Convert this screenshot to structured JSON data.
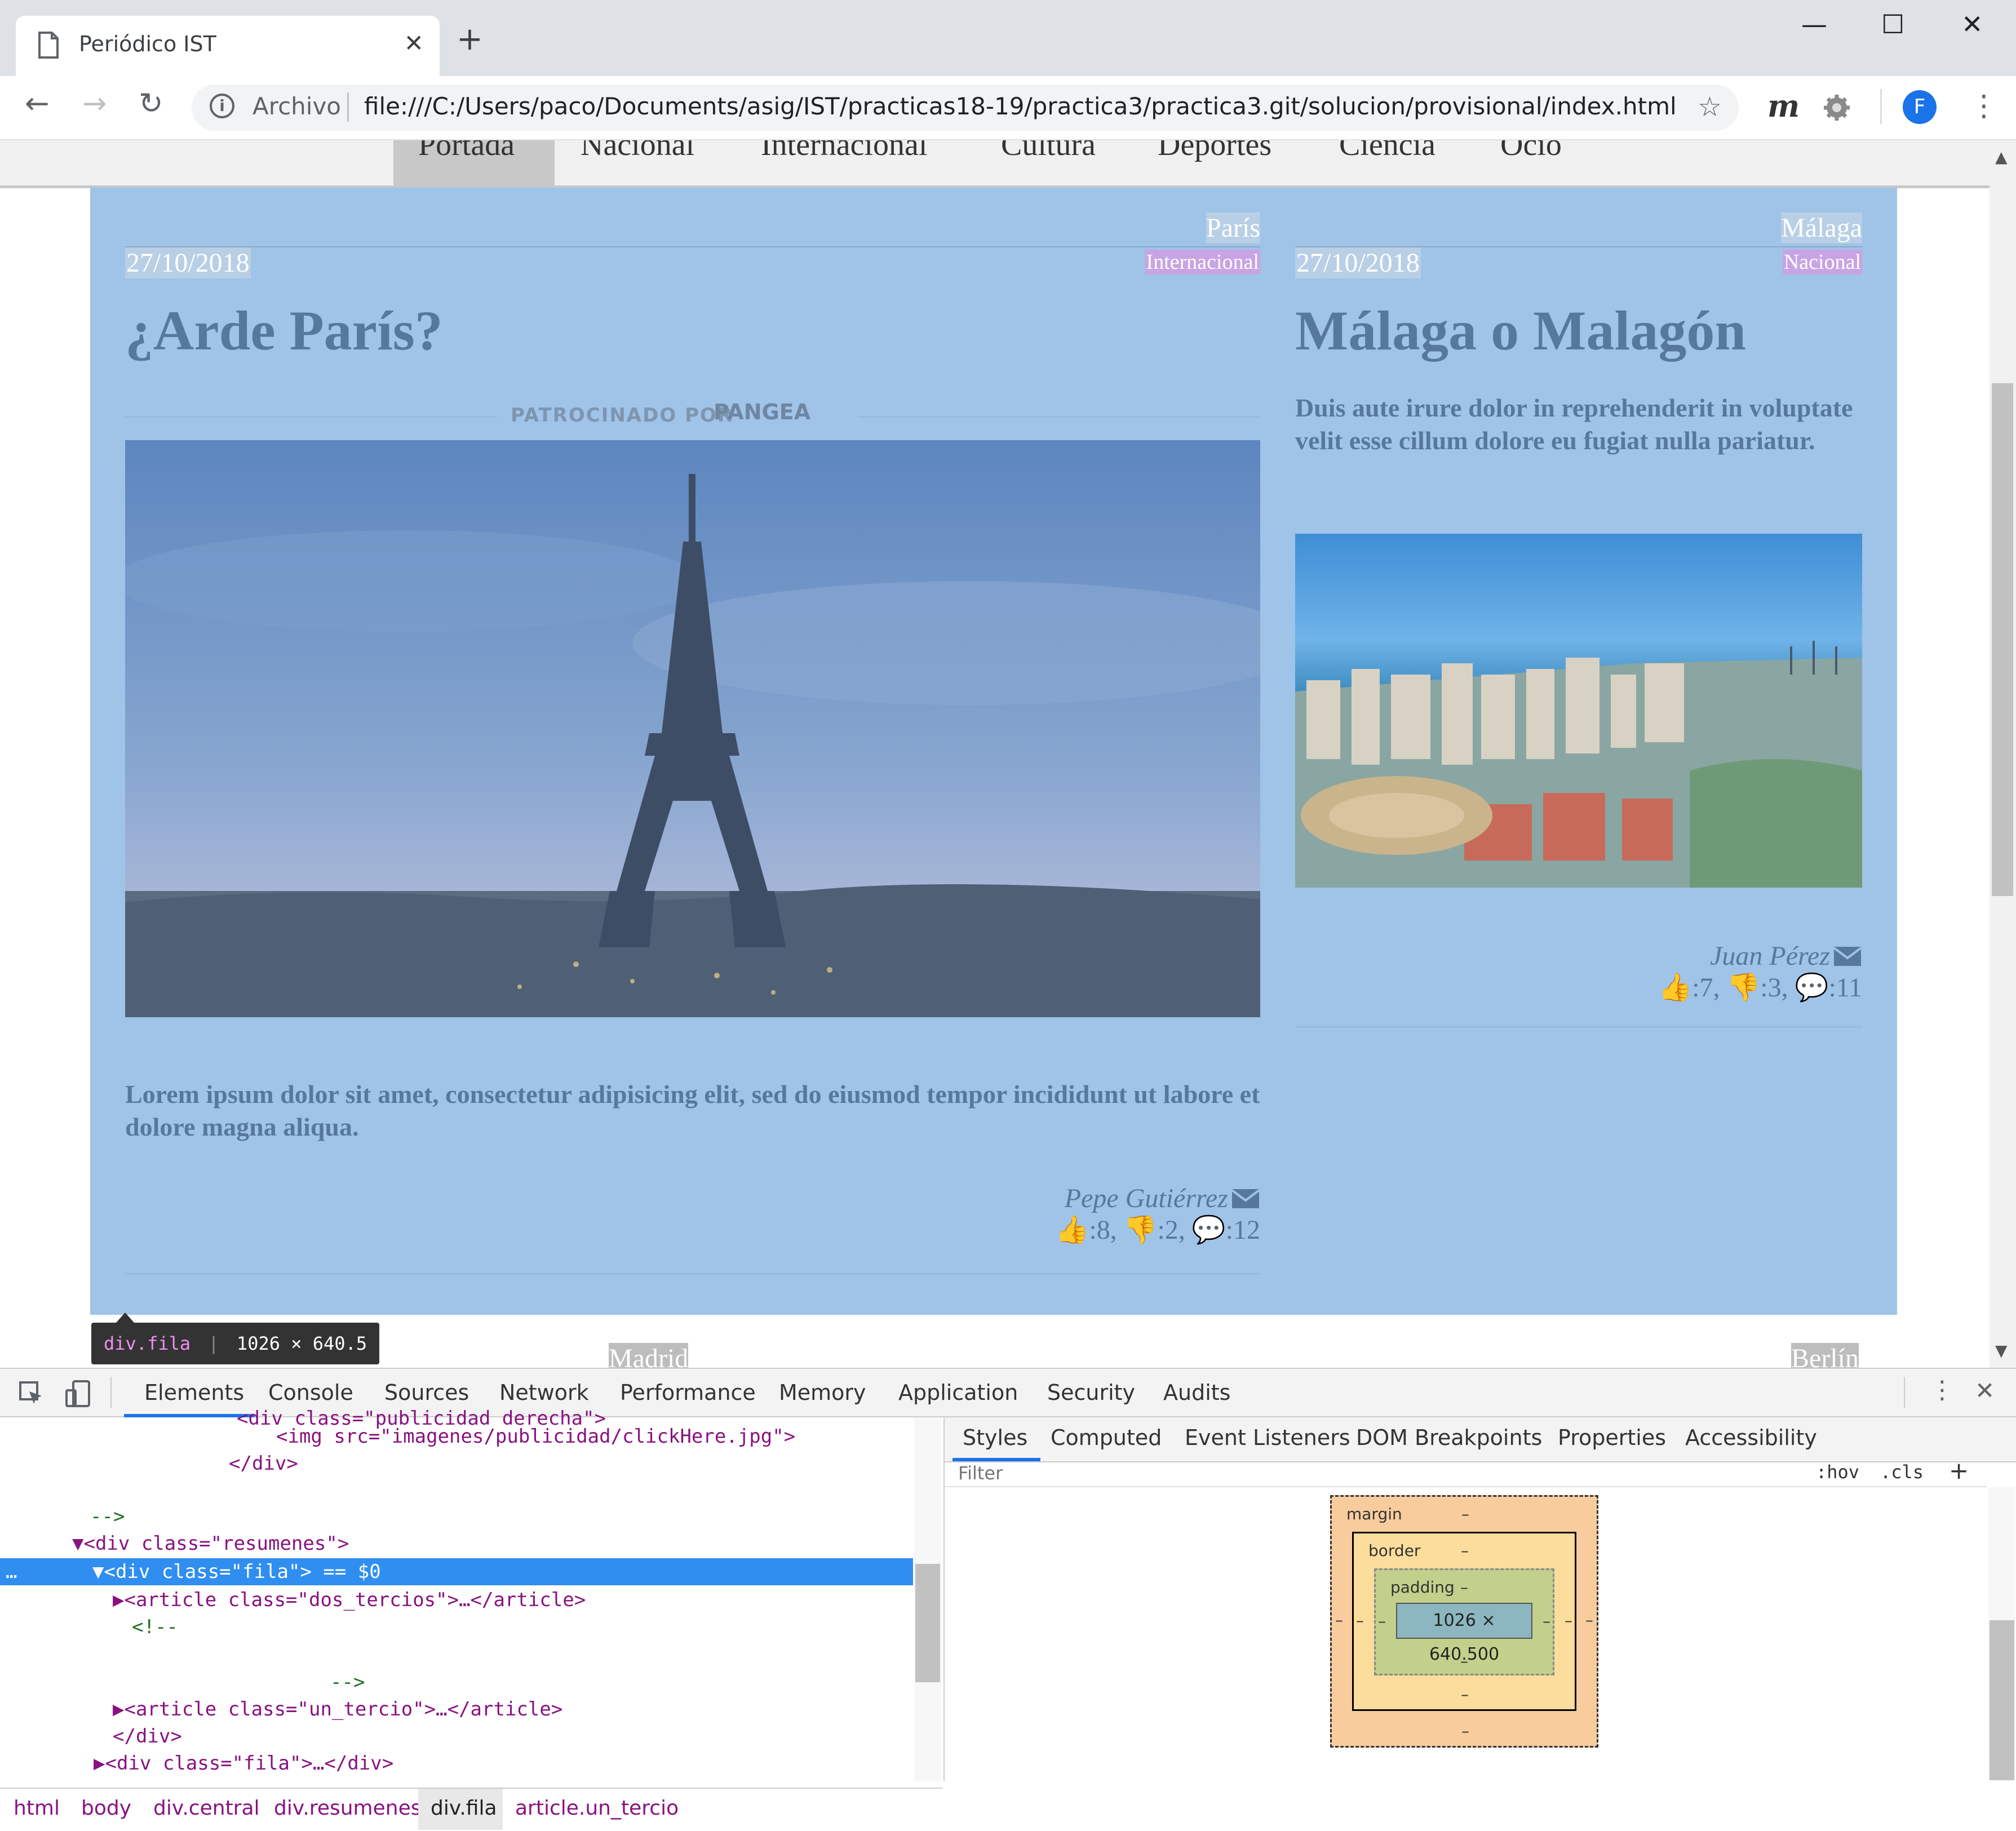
{
  "browser": {
    "tab_title": "Periódico IST",
    "tab_close": "✕",
    "new_tab": "+",
    "window_minimize": "—",
    "window_maximize": "☐",
    "window_close": "✕",
    "back": "←",
    "forward": "→",
    "reload": "↻",
    "scheme_label": "Archivo",
    "url": "file:///C:/Users/paco/Documents/asig/IST/practicas18-19/practica3/practica3.git/solucion/provisional/index.html",
    "bookmark": "☆",
    "ext_m": "m",
    "profile_initial": "F",
    "menu": "⋮"
  },
  "site": {
    "nav": [
      "Portada",
      "Nacional",
      "Internacional",
      "Cultura",
      "Deportes",
      "Ciencia",
      "Ocio"
    ],
    "articles": [
      {
        "place": "París",
        "date": "27/10/2018",
        "category": "Internacional",
        "headline": "¿Arde París?",
        "sponsor": "PATROCINADO POR",
        "sponsor_brand": "PANGEA",
        "summary": "Lorem ipsum dolor sit amet, consectetur adipisicing elit, sed do eiusmod tempor incididunt ut labore et dolore magna aliqua.",
        "author": "Pepe Gutiérrez",
        "likes": ":8,",
        "dislikes": ":2,",
        "comments": ":12"
      },
      {
        "place": "Málaga",
        "date": "27/10/2018",
        "category": "Nacional",
        "headline": "Málaga o Malagón",
        "summary": "Duis aute irure dolor in reprehenderit in voluptate velit esse cillum dolore eu fugiat nulla pariatur.",
        "author": "Juan Pérez",
        "likes": ":7,",
        "dislikes": ":3,",
        "comments": ":11"
      }
    ],
    "next_row_places": [
      "Madrid",
      "Berlín"
    ]
  },
  "inspector_tooltip": {
    "selector": "div.fila",
    "size": "1026 × 640.5"
  },
  "devtools": {
    "tabs": [
      "Elements",
      "Console",
      "Sources",
      "Network",
      "Performance",
      "Memory",
      "Application",
      "Security",
      "Audits"
    ],
    "active_tab": "Elements",
    "code_lines": [
      {
        "indent": "    ",
        "text": "<div class=\"publicidad derecha\">"
      },
      {
        "indent": "        ",
        "text": "<img src=\"imagenes/publicidad/clickHere.jpg\">"
      },
      {
        "indent": "    ",
        "text": "</div>"
      },
      {
        "indent": "",
        "text": ""
      },
      {
        "indent": "",
        "text": "-->"
      },
      {
        "indent": "",
        "text": "▼<div class=\"resumenes\">"
      },
      {
        "indent": "",
        "text": "▼<div class=\"fila\"> == $0"
      },
      {
        "indent": "",
        "text": "▶<article class=\"dos_tercios\">…</article>"
      },
      {
        "indent": "",
        "text": "<!--"
      },
      {
        "indent": "",
        "text": ""
      },
      {
        "indent": "",
        "text": "-->"
      },
      {
        "indent": "",
        "text": "▶<article class=\"un_tercio\">…</article>"
      },
      {
        "indent": "",
        "text": "</div>"
      },
      {
        "indent": "",
        "text": "▶<div class=\"fila\">…</div>"
      }
    ],
    "styles_tabs": [
      "Styles",
      "Computed",
      "Event Listeners",
      "DOM Breakpoints",
      "Properties",
      "Accessibility"
    ],
    "filter_placeholder": "Filter",
    "hov": ":hov",
    "cls": ".cls",
    "add": "+",
    "box_model": {
      "margin_label": "margin",
      "border_label": "border",
      "padding_label": "padding",
      "dash": "–",
      "content": "1026 × 640.500"
    },
    "breadcrumbs": [
      "html",
      "body",
      "div.central",
      "div.resumenes",
      "div.fila",
      "article.un_tercio"
    ],
    "selected_crumb": "div.fila"
  },
  "colors": {
    "overlay": "#a0c3e8",
    "category": "#c8a4e4",
    "selection": "#2f8ef0"
  }
}
